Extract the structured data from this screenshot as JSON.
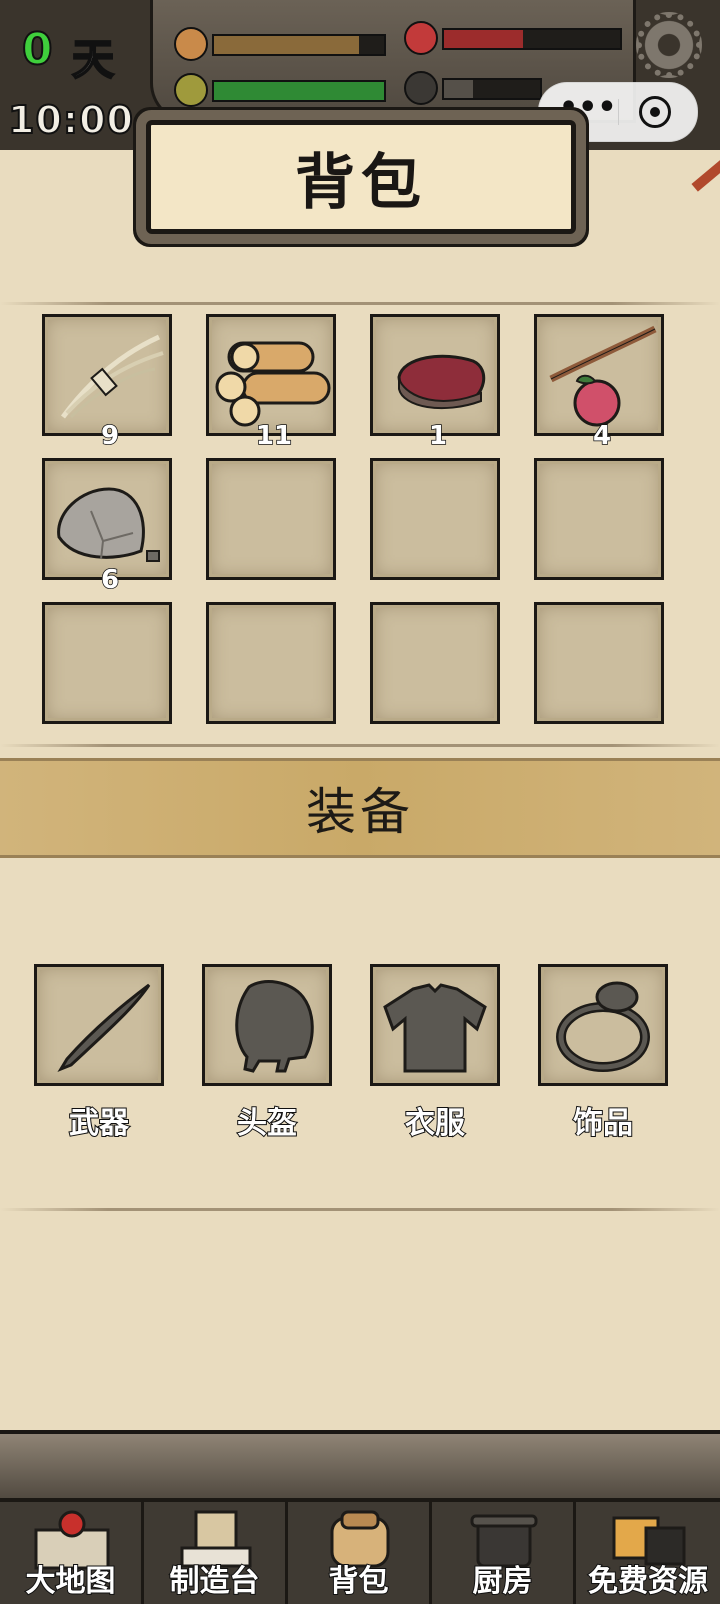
{
  "status": {
    "day_number": "0",
    "day_unit": "天",
    "time": "10:00",
    "stats": [
      {
        "name": "hunger",
        "icon": "drumstick-icon",
        "level": 0.85,
        "color": "#8a6a3a"
      },
      {
        "name": "health",
        "icon": "heart-icon",
        "level": 0.45,
        "color": "#9c2c2c"
      },
      {
        "name": "stamina",
        "icon": "leaf-icon",
        "level": 1.0,
        "color": "#2f8a34"
      },
      {
        "name": "sanity",
        "icon": "skull-icon",
        "level": 0.3,
        "color": "#555049"
      }
    ]
  },
  "miniprogram": {
    "more_icon": "•••",
    "close_icon": "target-icon"
  },
  "panel": {
    "title": "背包"
  },
  "backpack": {
    "items": [
      {
        "item": "grass-bundle",
        "count": "9"
      },
      {
        "item": "wood-logs",
        "count": "11"
      },
      {
        "item": "raw-meat",
        "count": "1"
      },
      {
        "item": "berry-branch",
        "count": "4"
      },
      {
        "item": "stone",
        "count": "6"
      },
      {
        "item": "",
        "count": ""
      },
      {
        "item": "",
        "count": ""
      },
      {
        "item": "",
        "count": ""
      },
      {
        "item": "",
        "count": ""
      },
      {
        "item": "",
        "count": ""
      },
      {
        "item": "",
        "count": ""
      },
      {
        "item": "",
        "count": ""
      }
    ]
  },
  "equipment": {
    "title": "装备",
    "slots": [
      {
        "label": "武器",
        "icon": "blade-icon"
      },
      {
        "label": "头盔",
        "icon": "helmet-icon"
      },
      {
        "label": "衣服",
        "icon": "armor-icon"
      },
      {
        "label": "饰品",
        "icon": "ring-icon"
      }
    ]
  },
  "nav": [
    {
      "label": "大地图",
      "icon": "map-icon"
    },
    {
      "label": "制造台",
      "icon": "workbench-icon"
    },
    {
      "label": "背包",
      "icon": "backpack-icon"
    },
    {
      "label": "厨房",
      "icon": "pot-icon"
    },
    {
      "label": "免费资源",
      "icon": "video-icon"
    }
  ]
}
